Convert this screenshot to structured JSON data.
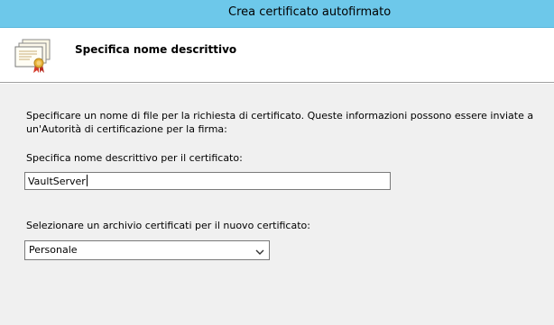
{
  "window": {
    "title": "Crea certificato autofirmato"
  },
  "header": {
    "title": "Specifica nome descrittivo",
    "icon": "certificate-icon"
  },
  "body": {
    "description_line1": "Specificare un nome di file per la richiesta di certificato. Queste informazioni possono essere inviate a",
    "description_line2": "un'Autorità di certificazione per la firma:",
    "friendly_name_label": "Specifica nome descrittivo per il certificato:",
    "friendly_name_value": "VaultServer",
    "store_label": "Selezionare un archivio certificati per il nuovo certificato:",
    "store_selected": "Personale"
  },
  "colors": {
    "titlebar": "#6dc8ea",
    "background": "#f0f0f0",
    "header_background": "#ffffff"
  }
}
